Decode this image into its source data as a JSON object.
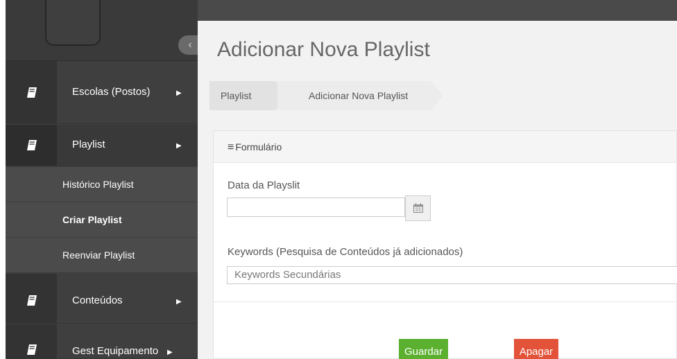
{
  "sidebar": {
    "collapse_icon": "‹",
    "items": [
      {
        "label": "Escolas (Postos)",
        "icon": "book-icon",
        "has_submenu": true
      },
      {
        "label": "Playlist",
        "icon": "book-icon",
        "has_submenu": true
      },
      {
        "label": "Conteúdos",
        "icon": "book-icon",
        "has_submenu": true
      },
      {
        "label": "Gest Equipamento",
        "icon": "book-icon",
        "has_submenu": true
      }
    ],
    "playlist_submenu": [
      {
        "label": "Histórico Playlist"
      },
      {
        "label": "Criar Playlist"
      },
      {
        "label": "Reenviar Playlist"
      }
    ],
    "caret": "▶"
  },
  "page": {
    "title": "Adicionar Nova Playlist"
  },
  "breadcrumb": {
    "items": [
      "Playlist",
      "Adicionar Nova Playlist"
    ]
  },
  "form": {
    "header": "Formulário",
    "header_icon": "hamburger-icon",
    "date_label": "Data da Playslit",
    "date_value": "",
    "date_icon": "calendar-icon",
    "keywords_label": "Keywords (Pesquisa de Conteúdos já adicionados)",
    "keywords_placeholder": "Keywords Secundárias",
    "save_label": "Guardar",
    "delete_label": "Apagar"
  },
  "colors": {
    "sidebar_bg": "#3f3f3f",
    "save_button": "#5bb12f",
    "delete_button": "#e2533a"
  }
}
